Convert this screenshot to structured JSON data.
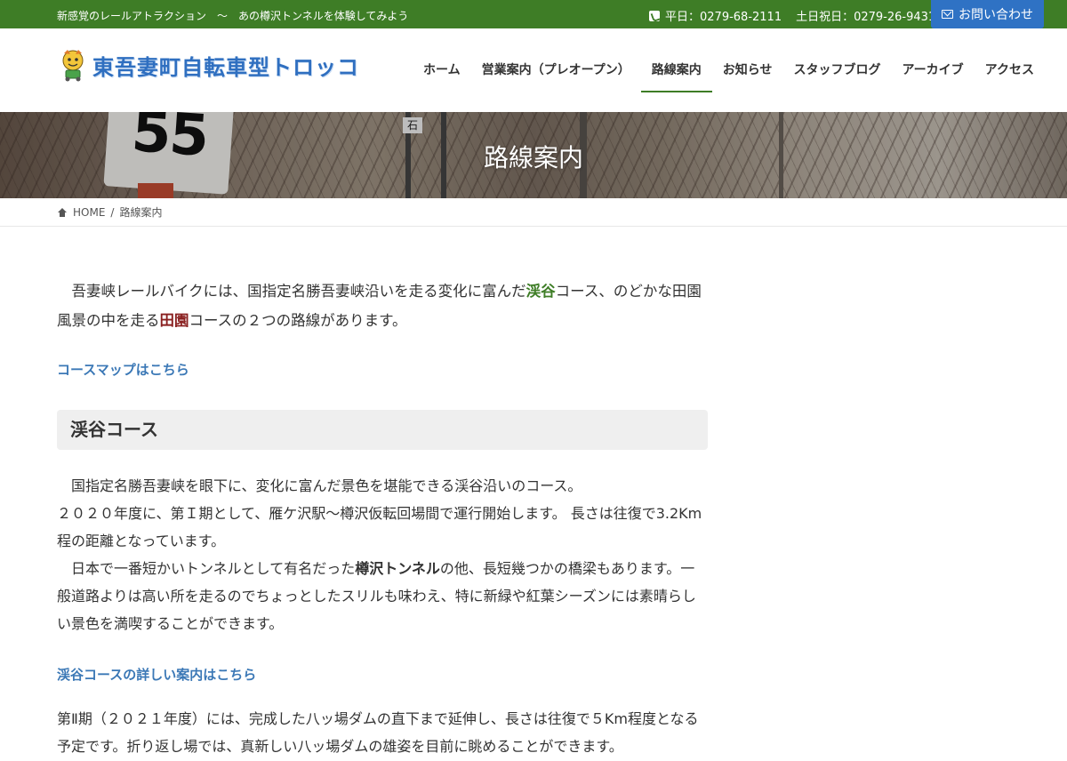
{
  "topbar": {
    "tagline": "新感覚のレールアトラクション　〜　あの樽沢トンネルを体験してみよう",
    "phone_weekday": "平日：0279-68-2111",
    "phone_weekend": "土日祝日：0279-26-9431",
    "contact_label": "お問い合わせ"
  },
  "header": {
    "logo_text": "東吾妻町自転車型トロッコ",
    "nav": [
      {
        "label": "ホーム"
      },
      {
        "label": "営業案内（プレオープン）"
      },
      {
        "label": "路線案内"
      },
      {
        "label": "お知らせ"
      },
      {
        "label": "スタッフブログ"
      },
      {
        "label": "アーカイブ"
      },
      {
        "label": "アクセス"
      }
    ]
  },
  "hero": {
    "title": "路線案内",
    "sign_number": "55",
    "small_sign": "石"
  },
  "breadcrumb": {
    "home": "HOME",
    "separator": "/",
    "current": "路線案内"
  },
  "content": {
    "intro_a": "　吾妻峡レールバイクには、国指定名勝吾妻峡沿いを走る変化に富んだ",
    "intro_green": "渓谷",
    "intro_b": "コース、のどかな田園風景の中を走る",
    "intro_red": "田園",
    "intro_c": "コースの２つの路線があります。",
    "map_link": "コースマップはこちら",
    "section_title": "渓谷コース",
    "body1_line1": "　国指定名勝吾妻峡を眼下に、変化に富んだ景色を堪能できる渓谷沿いのコース。",
    "body1_line2": "２０２０年度に、第Ｉ期として、雁ケ沢駅〜樽沢仮転回場間で運行開始します。 長さは往復で3.2Km程の距離となっています。",
    "body1_line3a": "　日本で一番短かいトンネルとして有名だった",
    "body1_bold": "樽沢トンネル",
    "body1_line3b": "の他、長短幾つかの橋梁もあります。一般道路よりは高い所を走るのでちょっとしたスリルも味わえ、特に新緑や紅葉シーズンには素晴らしい景色を満喫することができます。",
    "detail_link": "渓谷コースの詳しい案内はこちら",
    "body2": "第Ⅱ期（２０２１年度）には、完成した八ッ場ダムの直下まで延伸し、長さは往復で５Km程度となる予定です。折り返し場では、真新しい八ッ場ダムの雄姿を目前に眺めることができます。"
  },
  "colors": {
    "topbar_bg": "#3e7d26",
    "contact_bg": "#2f72c4",
    "link": "#3b78b6",
    "accent_green": "#3e7d26",
    "accent_red": "#8a2020"
  },
  "icons": [
    "phone-icon",
    "mail-icon",
    "home-icon",
    "mascot-icon"
  ]
}
